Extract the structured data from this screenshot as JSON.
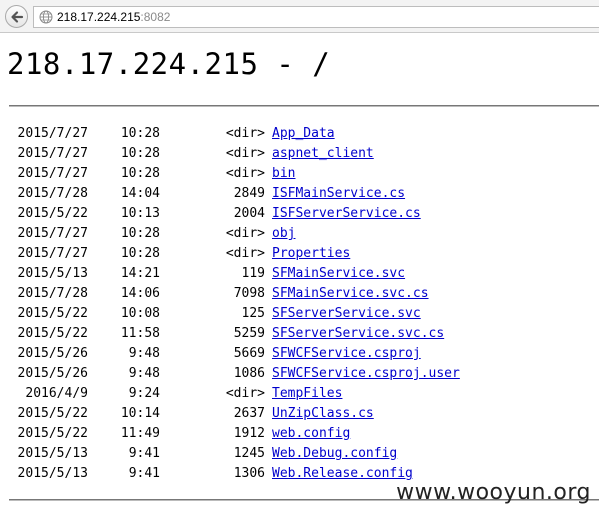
{
  "browser": {
    "url_host": "218.17.224.215",
    "url_port": ":8082"
  },
  "page": {
    "title": "218.17.224.215 - /"
  },
  "entries": [
    {
      "date": "2015/7/27",
      "time": "10:28",
      "size": "<dir>",
      "name": "App_Data"
    },
    {
      "date": "2015/7/27",
      "time": "10:28",
      "size": "<dir>",
      "name": "aspnet_client"
    },
    {
      "date": "2015/7/27",
      "time": "10:28",
      "size": "<dir>",
      "name": "bin"
    },
    {
      "date": "2015/7/28",
      "time": "14:04",
      "size": "2849",
      "name": "ISFMainService.cs"
    },
    {
      "date": "2015/5/22",
      "time": "10:13",
      "size": "2004",
      "name": "ISFServerService.cs"
    },
    {
      "date": "2015/7/27",
      "time": "10:28",
      "size": "<dir>",
      "name": "obj"
    },
    {
      "date": "2015/7/27",
      "time": "10:28",
      "size": "<dir>",
      "name": "Properties"
    },
    {
      "date": "2015/5/13",
      "time": "14:21",
      "size": "119",
      "name": "SFMainService.svc"
    },
    {
      "date": "2015/7/28",
      "time": "14:06",
      "size": "7098",
      "name": "SFMainService.svc.cs"
    },
    {
      "date": "2015/5/22",
      "time": "10:08",
      "size": "125",
      "name": "SFServerService.svc"
    },
    {
      "date": "2015/5/22",
      "time": "11:58",
      "size": "5259",
      "name": "SFServerService.svc.cs"
    },
    {
      "date": "2015/5/26",
      "time": "9:48",
      "size": "5669",
      "name": "SFWCFService.csproj"
    },
    {
      "date": "2015/5/26",
      "time": "9:48",
      "size": "1086",
      "name": "SFWCFService.csproj.user"
    },
    {
      "date": "2016/4/9",
      "time": "9:24",
      "size": "<dir>",
      "name": "TempFiles"
    },
    {
      "date": "2015/5/22",
      "time": "10:14",
      "size": "2637",
      "name": "UnZipClass.cs"
    },
    {
      "date": "2015/5/22",
      "time": "11:49",
      "size": "1912",
      "name": "web.config"
    },
    {
      "date": "2015/5/13",
      "time": "9:41",
      "size": "1245",
      "name": "Web.Debug.config"
    },
    {
      "date": "2015/5/13",
      "time": "9:41",
      "size": "1306",
      "name": "Web.Release.config"
    }
  ],
  "watermark": "www.wooyun.org",
  "icons": {
    "back": "back-arrow-icon",
    "site": "globe-icon"
  }
}
